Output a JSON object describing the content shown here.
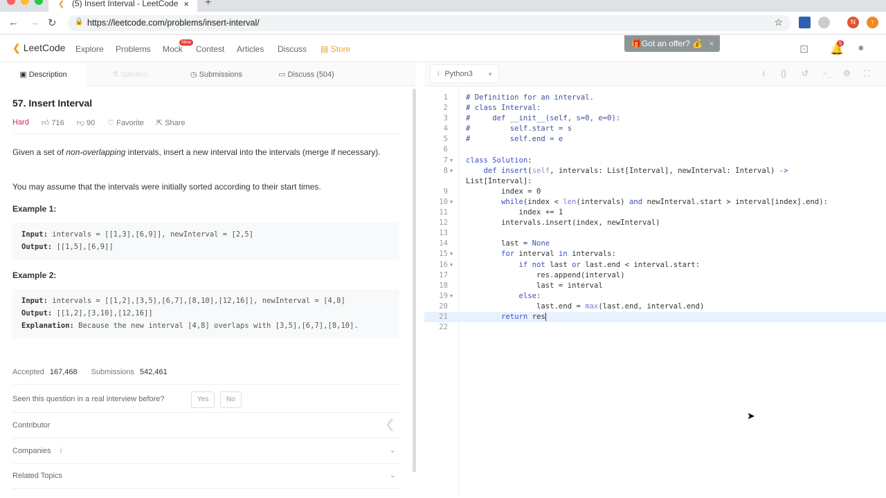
{
  "browser": {
    "tab_title": "(5) Insert Interval - LeetCode",
    "url": "https://leetcode.com/problems/insert-interval/",
    "profile_initial": "N"
  },
  "nav": {
    "brand": "LeetCode",
    "items": [
      "Explore",
      "Problems",
      "Mock",
      "Contest",
      "Articles",
      "Discuss"
    ],
    "new_badge": "New",
    "store": "Store",
    "offer": "Got an offer?",
    "notifications": "5"
  },
  "tabs": {
    "description": "Description",
    "solution": "Solution",
    "submissions": "Submissions",
    "discuss": "Discuss (504)"
  },
  "problem": {
    "title": "57. Insert Interval",
    "difficulty": "Hard",
    "likes": "716",
    "dislikes": "90",
    "favorite": "Favorite",
    "share": "Share",
    "p1_a": "Given a set of ",
    "p1_em": "non-overlapping",
    "p1_b": " intervals, insert a new interval into the intervals (merge if necessary).",
    "p2": "You may assume that the intervals were initially sorted according to their start times.",
    "ex1_title": "Example 1:",
    "ex1_input_label": "Input:",
    "ex1_input": " intervals = [[1,3],[6,9]], newInterval = [2,5]",
    "ex1_output_label": "Output:",
    "ex1_output": " [[1,5],[6,9]]",
    "ex2_title": "Example 2:",
    "ex2_input_label": "Input:",
    "ex2_input": " intervals = [[1,2],[3,5],[6,7],[8,10],[12,16]], newInterval = [4,8]",
    "ex2_output_label": "Output:",
    "ex2_output": " [[1,2],[3,10],[12,16]]",
    "ex2_expl_label": "Explanation:",
    "ex2_expl": " Because the new interval [4,8] overlaps with [3,5],[6,7],[8,10].",
    "accepted_label": "Accepted",
    "accepted": "167,468",
    "submissions_label": "Submissions",
    "submissions": "542,461",
    "interview_q": "Seen this question in a real interview before?",
    "yes": "Yes",
    "no": "No",
    "contributor": "Contributor",
    "companies": "Companies",
    "companies_info": "i",
    "related": "Related Topics"
  },
  "editor": {
    "language": "Python3",
    "lines": [
      {
        "n": "1",
        "t": [
          [
            "c",
            "# Definition for an interval."
          ]
        ]
      },
      {
        "n": "2",
        "t": [
          [
            "c",
            "# class Interval:"
          ]
        ]
      },
      {
        "n": "3",
        "t": [
          [
            "c",
            "#     def __init__(self, s=0, e=0):"
          ]
        ]
      },
      {
        "n": "4",
        "t": [
          [
            "c",
            "#         self.start = s"
          ]
        ]
      },
      {
        "n": "5",
        "t": [
          [
            "c",
            "#         self.end = e"
          ]
        ]
      },
      {
        "n": "6",
        "t": []
      },
      {
        "n": "7",
        "f": true,
        "t": [
          [
            "k",
            "class Solution"
          ],
          [
            "n",
            ":"
          ]
        ]
      },
      {
        "n": "8",
        "f": true,
        "t": [
          [
            "n",
            "    "
          ],
          [
            "k",
            "def insert"
          ],
          [
            "n",
            "("
          ],
          [
            "s",
            "self"
          ],
          [
            "n",
            ", intervals: List[Interval], newInterval: Interval) "
          ],
          [
            "k",
            "->"
          ]
        ]
      },
      {
        "n": "",
        "t": [
          [
            "n",
            "List[Interval]:"
          ]
        ]
      },
      {
        "n": "9",
        "t": [
          [
            "n",
            "        index = 0"
          ]
        ]
      },
      {
        "n": "10",
        "f": true,
        "t": [
          [
            "n",
            "        "
          ],
          [
            "k",
            "while"
          ],
          [
            "n",
            "(index < "
          ],
          [
            "b",
            "len"
          ],
          [
            "n",
            "(intervals) "
          ],
          [
            "k",
            "and"
          ],
          [
            "n",
            " newInterval.start > interval[index].end):"
          ]
        ]
      },
      {
        "n": "11",
        "t": [
          [
            "n",
            "            index += 1"
          ]
        ]
      },
      {
        "n": "12",
        "t": [
          [
            "n",
            "        intervals.insert(index, newInterval)"
          ]
        ]
      },
      {
        "n": "13",
        "t": []
      },
      {
        "n": "14",
        "t": [
          [
            "n",
            "        last = "
          ],
          [
            "k",
            "None"
          ]
        ]
      },
      {
        "n": "15",
        "f": true,
        "t": [
          [
            "n",
            "        "
          ],
          [
            "k",
            "for"
          ],
          [
            "n",
            " interval "
          ],
          [
            "k",
            "in"
          ],
          [
            "n",
            " intervals:"
          ]
        ]
      },
      {
        "n": "16",
        "f": true,
        "t": [
          [
            "n",
            "            "
          ],
          [
            "k",
            "if not"
          ],
          [
            "n",
            " last "
          ],
          [
            "k",
            "or"
          ],
          [
            "n",
            " last.end < interval.start:"
          ]
        ]
      },
      {
        "n": "17",
        "t": [
          [
            "n",
            "                res.append(interval)"
          ]
        ]
      },
      {
        "n": "18",
        "t": [
          [
            "n",
            "                last = interval"
          ]
        ]
      },
      {
        "n": "19",
        "f": true,
        "t": [
          [
            "n",
            "            "
          ],
          [
            "k",
            "else"
          ],
          [
            "n",
            ":"
          ]
        ]
      },
      {
        "n": "20",
        "t": [
          [
            "n",
            "                last.end = "
          ],
          [
            "b",
            "max"
          ],
          [
            "n",
            "(last.end, interval.end)"
          ]
        ]
      },
      {
        "n": "21",
        "cur": true,
        "t": [
          [
            "n",
            "        "
          ],
          [
            "k",
            "return"
          ],
          [
            "n",
            " res"
          ]
        ]
      },
      {
        "n": "22",
        "t": []
      }
    ]
  }
}
